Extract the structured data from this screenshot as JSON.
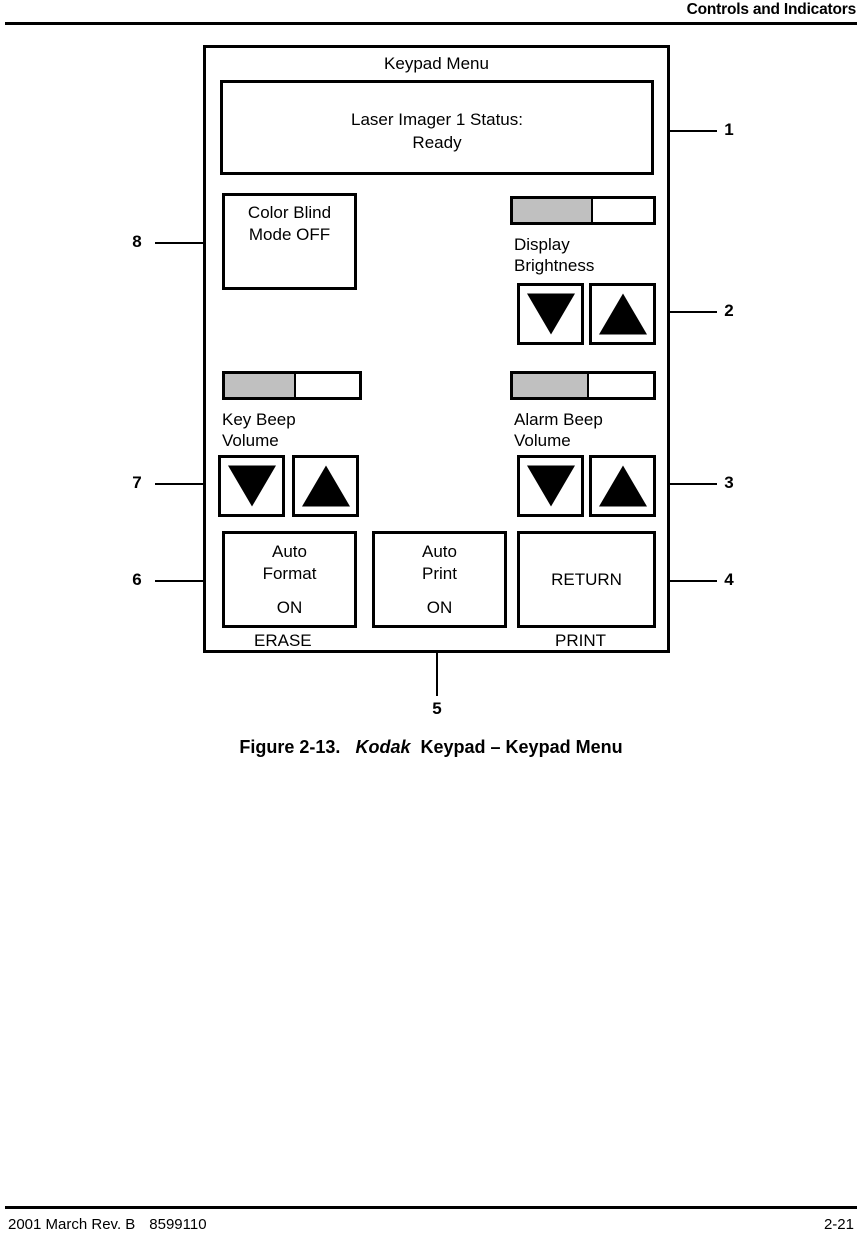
{
  "header": {
    "title": "Controls and Indicators"
  },
  "figure": {
    "caption_prefix": "Figure 2-13.",
    "caption_brand": "Kodak",
    "caption_rest": "Keypad – Keypad Menu"
  },
  "keypad": {
    "title": "Keypad Menu",
    "status_display": {
      "line1": "Laser Imager 1 Status:",
      "line2": "Ready",
      "text": "Laser Imager 1 Status:\nReady"
    },
    "color_blind_button": {
      "line1": "Color",
      "line2": "Blind",
      "line3": "Mode",
      "value": "OFF",
      "text": "Color\nBlind\nMode\nOFF"
    },
    "display_brightness": {
      "label": "Display\nBrightness",
      "label_line1": "Display",
      "label_line2": "Brightness",
      "fill_percent": 57,
      "decrease_icon": "triangle-down-icon",
      "increase_icon": "triangle-up-icon"
    },
    "key_beep_volume": {
      "label": "Key Beep\nVolume",
      "label_line1": "Key Beep",
      "label_line2": "Volume",
      "fill_percent": 53,
      "decrease_icon": "triangle-down-icon",
      "increase_icon": "triangle-up-icon"
    },
    "alarm_beep_volume": {
      "label": "Alarm Beep\nVolume",
      "label_line1": "Alarm Beep",
      "label_line2": "Volume",
      "fill_percent": 54,
      "decrease_icon": "triangle-down-icon",
      "increase_icon": "triangle-up-icon"
    },
    "auto_format_button": {
      "label": "Auto\nFormat",
      "value": "ON"
    },
    "auto_print_button": {
      "label": "Auto\nPrint",
      "value": "ON"
    },
    "return_button": {
      "label": "RETURN"
    },
    "erase_legend": "ERASE",
    "print_legend": "PRINT"
  },
  "callouts": [
    {
      "number": "1"
    },
    {
      "number": "2"
    },
    {
      "number": "3"
    },
    {
      "number": "4"
    },
    {
      "number": "5"
    },
    {
      "number": "6"
    },
    {
      "number": "7"
    },
    {
      "number": "8"
    }
  ],
  "footer": {
    "date": "2001 March Rev. B",
    "doc_number": "8599110",
    "page_number": "2-21"
  },
  "colors": {
    "ink": "#000000",
    "paper": "#ffffff",
    "gauge_fill": "#c0c0c0"
  }
}
